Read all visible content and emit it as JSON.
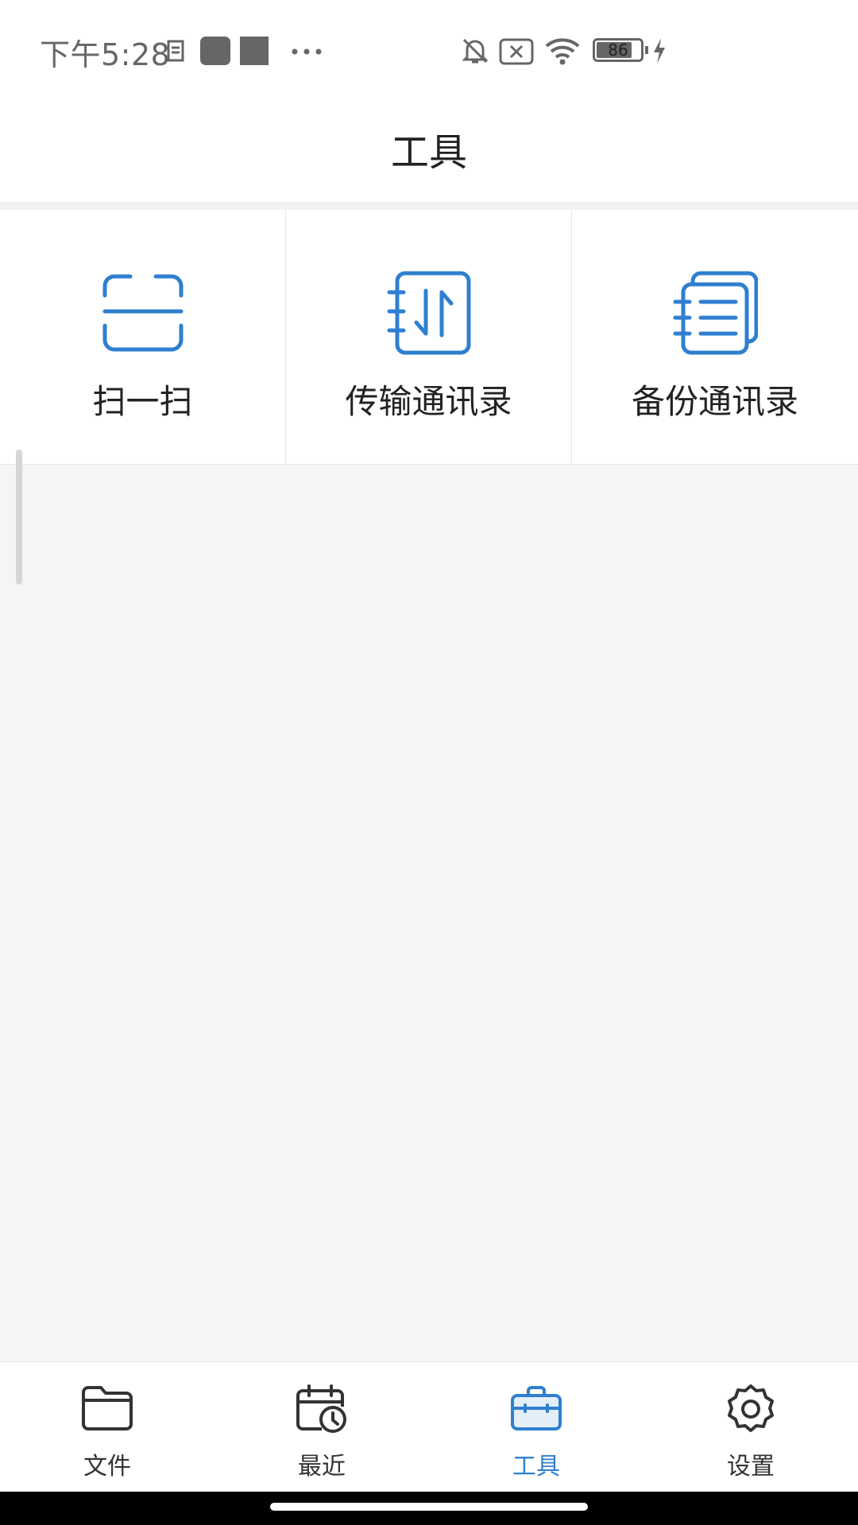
{
  "status_bar": {
    "time": "下午5:28",
    "battery": "86",
    "icons": [
      "sim-icon",
      "notification-square-icon",
      "notification-square-icon",
      "more-dots-icon",
      "bell-muted-icon",
      "sim-x-icon",
      "wifi-icon",
      "battery-icon",
      "charging-icon"
    ]
  },
  "header": {
    "title": "工具"
  },
  "tools": [
    {
      "label": "扫一扫",
      "icon": "scan-icon"
    },
    {
      "label": "传输通讯录",
      "icon": "transfer-contacts-icon"
    },
    {
      "label": "备份通讯录",
      "icon": "backup-contacts-icon"
    }
  ],
  "bottom_nav": [
    {
      "label": "文件",
      "icon": "folder-icon",
      "active": false
    },
    {
      "label": "最近",
      "icon": "calendar-clock-icon",
      "active": false
    },
    {
      "label": "工具",
      "icon": "toolbox-icon",
      "active": true
    },
    {
      "label": "设置",
      "icon": "gear-icon",
      "active": false
    }
  ],
  "colors": {
    "accent": "#2f7fd0",
    "background": "#f5f5f5",
    "surface": "#ffffff"
  }
}
